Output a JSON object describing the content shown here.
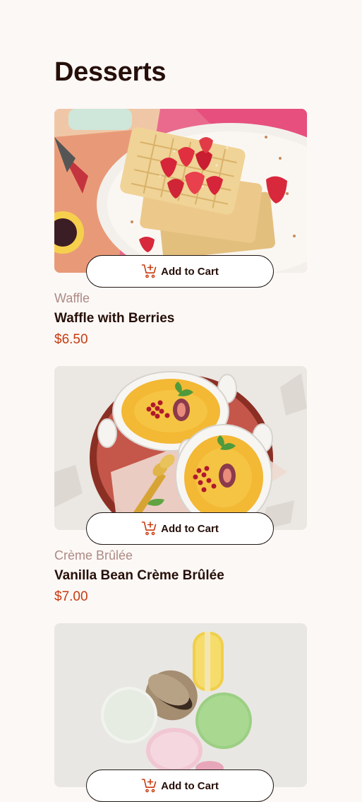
{
  "page": {
    "title": "Desserts"
  },
  "products": [
    {
      "category": "Waffle",
      "name": "Waffle with Berries",
      "price": "$6.50",
      "button_label": "Add to Cart"
    },
    {
      "category": "Crème Brûlée",
      "name": "Vanilla Bean Crème Brûlée",
      "price": "$7.00",
      "button_label": "Add to Cart"
    },
    {
      "button_label": "Add to Cart"
    }
  ],
  "colors": {
    "background": "#fcf8f6",
    "text": "#260f08",
    "category": "#ad8a85",
    "price": "#c73b0f",
    "accent": "#c73b0f"
  },
  "icons": {
    "cart": "add-to-cart-icon"
  }
}
